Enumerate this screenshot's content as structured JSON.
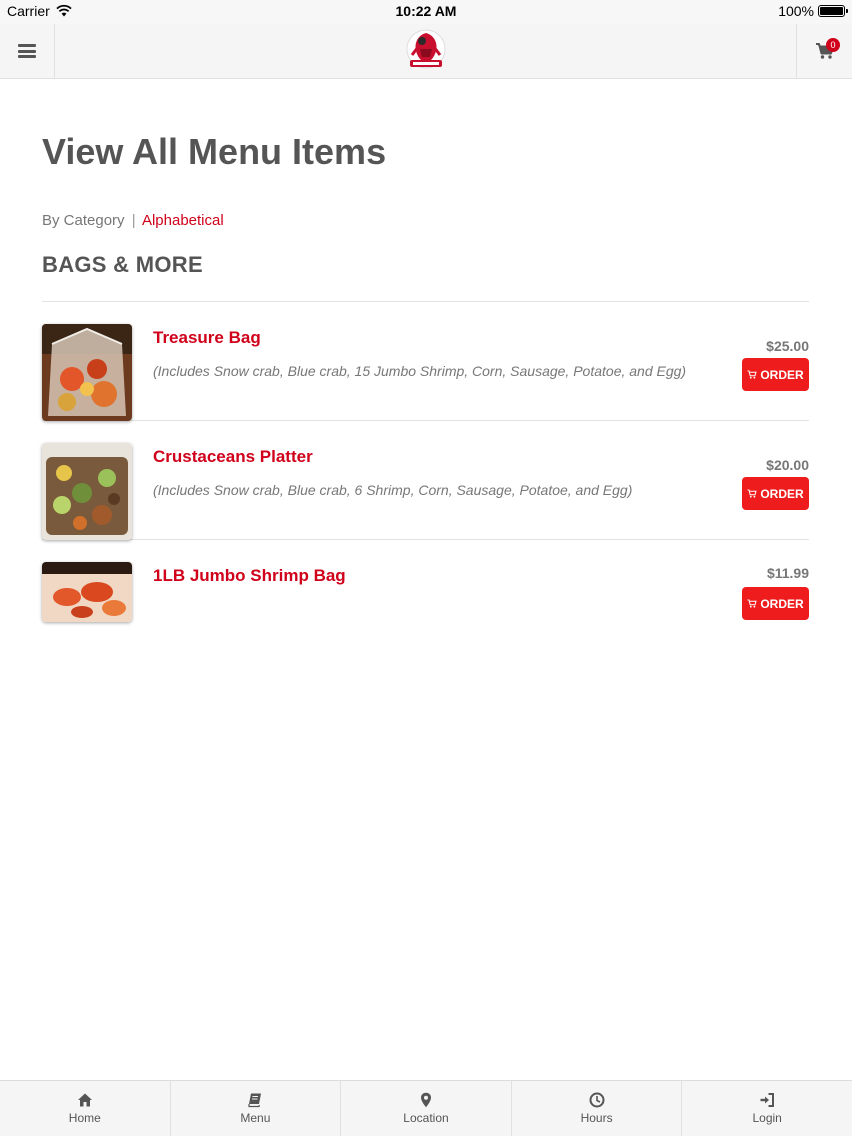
{
  "status_bar": {
    "carrier": "Carrier",
    "time": "10:22 AM",
    "battery": "100%"
  },
  "header": {
    "cart_count": "0"
  },
  "main": {
    "title": "View All Menu Items",
    "view_toggle": {
      "by_category": "By Category",
      "separator": "|",
      "alphabetical": "Alphabetical"
    },
    "category": "BAGS & MORE",
    "items": [
      {
        "name": "Treasure Bag",
        "description": "(Includes Snow crab, Blue crab, 15 Jumbo Shrimp, Corn, Sausage, Potatoe, and Egg)",
        "price": "$25.00",
        "order_label": "ORDER"
      },
      {
        "name": "Crustaceans Platter",
        "description": "(Includes Snow crab, Blue crab, 6 Shrimp, Corn, Sausage, Potatoe, and Egg)",
        "price": "$20.00",
        "order_label": "ORDER"
      },
      {
        "name": "1LB Jumbo Shrimp Bag",
        "description": "",
        "price": "$11.99",
        "order_label": "ORDER"
      }
    ]
  },
  "tab_bar": {
    "tabs": [
      {
        "label": "Home",
        "icon": "home-icon"
      },
      {
        "label": "Menu",
        "icon": "book-icon"
      },
      {
        "label": "Location",
        "icon": "map-pin-icon"
      },
      {
        "label": "Hours",
        "icon": "clock-icon"
      },
      {
        "label": "Login",
        "icon": "sign-in-icon"
      }
    ]
  },
  "colors": {
    "accent": "#d0021b",
    "order_button": "#ee1c1c",
    "text": "#555555"
  }
}
